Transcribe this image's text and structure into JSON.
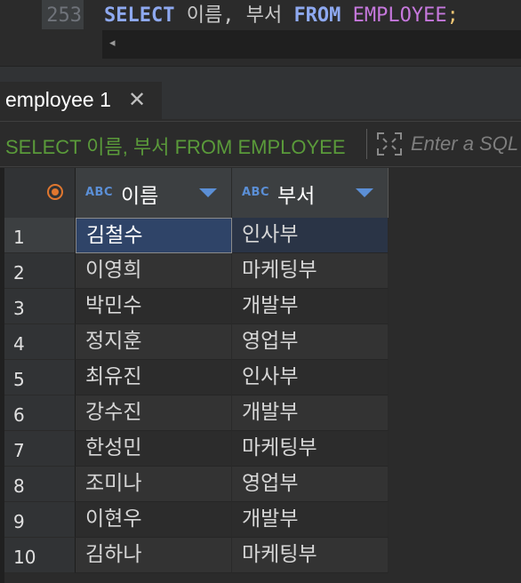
{
  "editor": {
    "line_number": "253",
    "code": {
      "kw_select": "SELECT",
      "cols": " 이름, 부서 ",
      "kw_from": "FROM",
      "space": " ",
      "table": "EMPLOYEE",
      "semicolon": ";"
    },
    "scroll_left_glyph": "◂"
  },
  "result_tab": {
    "label": "employee 1",
    "close_glyph": "✕"
  },
  "filter_bar": {
    "query_text": "SELECT 이름, 부서 FROM EMPLOYEE",
    "placeholder": "Enter a SQL expression to filter results (use Ctrl+Space)"
  },
  "grid": {
    "columns": [
      {
        "type_badge": "ABC",
        "title": "이름"
      },
      {
        "type_badge": "ABC",
        "title": "부서"
      }
    ],
    "rows": [
      {
        "num": "1",
        "name": "김철수",
        "dept": "인사부"
      },
      {
        "num": "2",
        "name": "이영희",
        "dept": "마케팅부"
      },
      {
        "num": "3",
        "name": "박민수",
        "dept": "개발부"
      },
      {
        "num": "4",
        "name": "정지훈",
        "dept": "영업부"
      },
      {
        "num": "5",
        "name": "최유진",
        "dept": "인사부"
      },
      {
        "num": "6",
        "name": "강수진",
        "dept": "개발부"
      },
      {
        "num": "7",
        "name": "한성민",
        "dept": "마케팅부"
      },
      {
        "num": "8",
        "name": "조미나",
        "dept": "영업부"
      },
      {
        "num": "9",
        "name": "이현우",
        "dept": "개발부"
      },
      {
        "num": "10",
        "name": "김하나",
        "dept": "마케팅부"
      }
    ]
  },
  "colors": {
    "keyword": "#8ea9f0",
    "table_name": "#c678dd",
    "filter_text": "#5a9a3a",
    "type_badge": "#5b8fd6",
    "selected_cell": "#2f4468",
    "corner_icon": "#e0772f"
  }
}
